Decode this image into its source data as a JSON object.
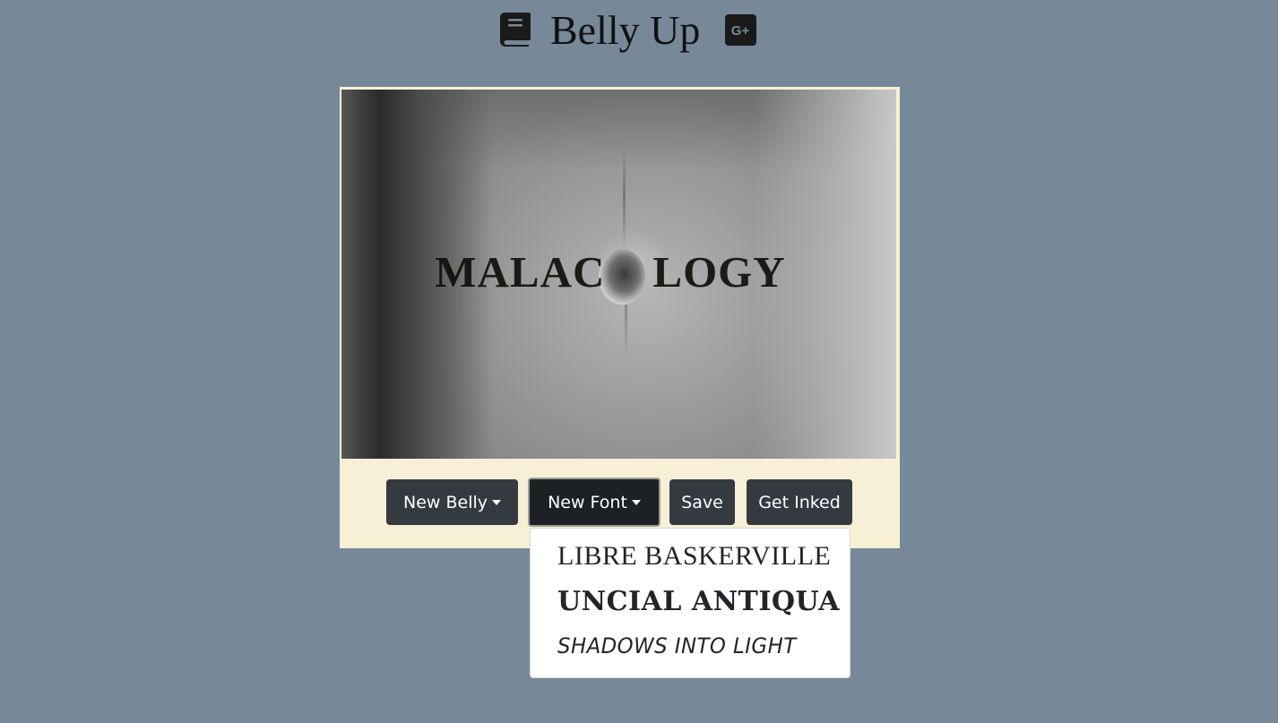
{
  "header": {
    "title": "Belly Up",
    "icons": [
      "book-icon",
      "google-plus-icon"
    ]
  },
  "preview": {
    "tattoo_text": "MALAC    LOGY"
  },
  "toolbar": {
    "new_belly_label": "New Belly",
    "new_font_label": "New Font",
    "save_label": "Save",
    "get_inked_label": "Get Inked"
  },
  "font_menu": {
    "items": [
      {
        "label": "LIBRE BASKERVILLE"
      },
      {
        "label": "UNCIAL ANTIQUA"
      },
      {
        "label": "SHADOWS INTO LIGHT"
      }
    ]
  },
  "colors": {
    "background": "#778899",
    "card": "#f7f0d6",
    "button": "#343a40",
    "button_active": "#1d2124"
  }
}
